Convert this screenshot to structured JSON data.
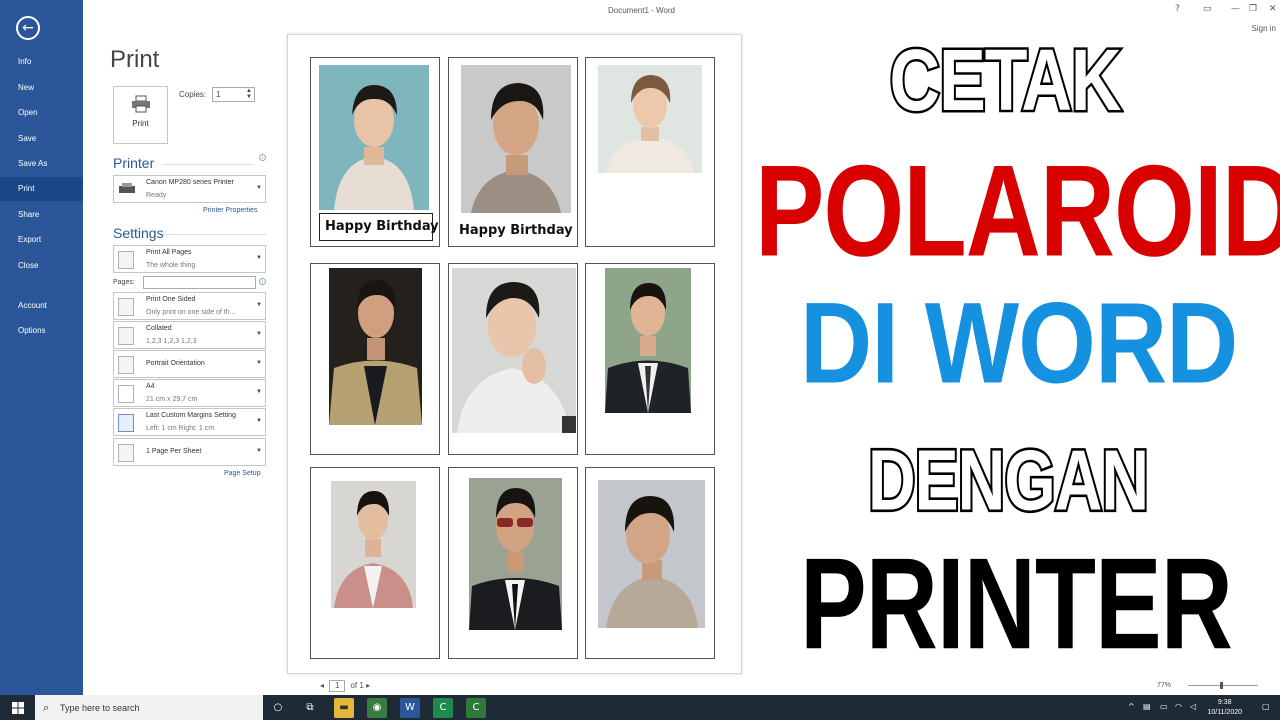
{
  "window": {
    "title": "Document1 - Word",
    "sign_in": "Sign in",
    "help": "?",
    "minimize": "—",
    "restore": "❐",
    "close": "✕"
  },
  "nav": {
    "back_glyph": "←",
    "items": [
      "Info",
      "New",
      "Open",
      "Save",
      "Save As",
      "Print",
      "Share",
      "Export",
      "Close",
      "Account",
      "Options"
    ],
    "active": "Print"
  },
  "print_panel": {
    "heading": "Print",
    "print_button_label": "Print",
    "copies_label": "Copies:",
    "copies_value": "1",
    "printer_heading": "Printer",
    "printer_name": "Canon MP280 series Printer",
    "printer_status": "Ready",
    "printer_properties": "Printer Properties",
    "settings_heading": "Settings",
    "pages_label": "Pages:",
    "page_setup": "Page Setup",
    "settings": [
      {
        "main": "Print All Pages",
        "sub": "The whole thing"
      },
      {
        "main": "Print One Sided",
        "sub": "Only print on one side of th..."
      },
      {
        "main": "Collated",
        "sub": "1,2,3    1,2,3    1,2,3"
      },
      {
        "main": "Portrait Orientation",
        "sub": ""
      },
      {
        "main": "A4",
        "sub": "21 cm x 29,7 cm"
      },
      {
        "main": "Last Custom Margins Setting",
        "sub": "Left:  1 cm    Right:  1 cm"
      },
      {
        "main": "1 Page Per Sheet",
        "sub": ""
      }
    ]
  },
  "preview": {
    "captions": [
      "Happy Birthday",
      "Happy Birthday"
    ],
    "page_current": "1",
    "page_total_label": "of 1",
    "zoom": "77%"
  },
  "overlay": {
    "line1": "CETAK",
    "line2": "POLAROID",
    "line3": "DI WORD",
    "line4": "DENGAN",
    "line5": "PRINTER"
  },
  "taskbar": {
    "search_placeholder": "Type here to search",
    "time": "9:38",
    "date": "10/11/2020"
  }
}
